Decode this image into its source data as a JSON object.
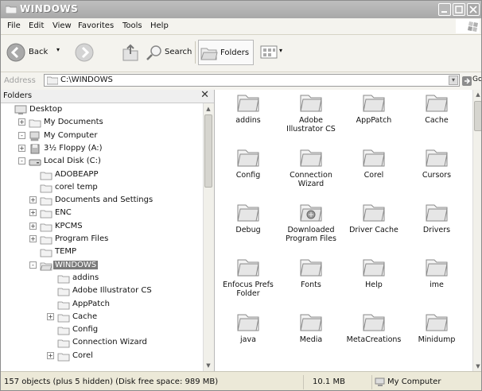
{
  "window": {
    "title": "WINDOWS"
  },
  "menu": [
    "File",
    "Edit",
    "View",
    "Favorites",
    "Tools",
    "Help"
  ],
  "toolbar": {
    "back": "Back",
    "search": "Search",
    "folders": "Folders"
  },
  "address": {
    "label": "Address",
    "value": "C:\\WINDOWS",
    "go": "Go"
  },
  "folders_pane": {
    "title": "Folders",
    "tree": [
      {
        "label": "Desktop",
        "icon": "desktop-icon",
        "level": 0,
        "expander": ""
      },
      {
        "label": "My Documents",
        "icon": "folder-icon",
        "level": 1,
        "expander": "+"
      },
      {
        "label": "My Computer",
        "icon": "computer-icon",
        "level": 1,
        "expander": "-"
      },
      {
        "label": "3½ Floppy (A:)",
        "icon": "floppy-icon",
        "level": 2,
        "expander": "+"
      },
      {
        "label": "Local Disk (C:)",
        "icon": "disk-icon",
        "level": 2,
        "expander": "-"
      },
      {
        "label": "ADOBEAPP",
        "icon": "folder-icon",
        "level": 3,
        "expander": ""
      },
      {
        "label": "corel temp",
        "icon": "folder-icon",
        "level": 3,
        "expander": ""
      },
      {
        "label": "Documents and Settings",
        "icon": "folder-icon",
        "level": 3,
        "expander": "+"
      },
      {
        "label": "ENC",
        "icon": "folder-icon",
        "level": 3,
        "expander": "+"
      },
      {
        "label": "KPCMS",
        "icon": "folder-icon",
        "level": 3,
        "expander": "+"
      },
      {
        "label": "Program Files",
        "icon": "folder-icon",
        "level": 3,
        "expander": "+"
      },
      {
        "label": "TEMP",
        "icon": "folder-icon",
        "level": 3,
        "expander": ""
      },
      {
        "label": "WINDOWS",
        "icon": "folder-open-icon",
        "level": 3,
        "expander": "-",
        "selected": true
      },
      {
        "label": "addins",
        "icon": "folder-icon",
        "level": 4,
        "expander": ""
      },
      {
        "label": "Adobe Illustrator CS",
        "icon": "folder-icon",
        "level": 4,
        "expander": ""
      },
      {
        "label": "AppPatch",
        "icon": "folder-icon",
        "level": 4,
        "expander": ""
      },
      {
        "label": "Cache",
        "icon": "folder-icon",
        "level": 4,
        "expander": "+"
      },
      {
        "label": "Config",
        "icon": "folder-icon",
        "level": 4,
        "expander": ""
      },
      {
        "label": "Connection Wizard",
        "icon": "folder-icon",
        "level": 4,
        "expander": ""
      },
      {
        "label": "Corel",
        "icon": "folder-icon",
        "level": 4,
        "expander": "+"
      }
    ]
  },
  "content": {
    "items": [
      {
        "name": "addins",
        "icon": "folder-icon"
      },
      {
        "name": "Adobe Illustrator CS",
        "icon": "folder-icon"
      },
      {
        "name": "AppPatch",
        "icon": "folder-icon"
      },
      {
        "name": "Cache",
        "icon": "folder-icon"
      },
      {
        "name": "Config",
        "icon": "folder-icon"
      },
      {
        "name": "Connection Wizard",
        "icon": "folder-icon"
      },
      {
        "name": "Corel",
        "icon": "folder-icon"
      },
      {
        "name": "Cursors",
        "icon": "folder-icon"
      },
      {
        "name": "Debug",
        "icon": "folder-icon"
      },
      {
        "name": "Downloaded Program Files",
        "icon": "folder-special-icon"
      },
      {
        "name": "Driver Cache",
        "icon": "folder-icon"
      },
      {
        "name": "Drivers",
        "icon": "folder-icon"
      },
      {
        "name": "Enfocus Prefs Folder",
        "icon": "folder-icon"
      },
      {
        "name": "Fonts",
        "icon": "folder-icon"
      },
      {
        "name": "Help",
        "icon": "folder-icon"
      },
      {
        "name": "ime",
        "icon": "folder-icon"
      },
      {
        "name": "java",
        "icon": "folder-icon"
      },
      {
        "name": "Media",
        "icon": "folder-icon"
      },
      {
        "name": "MetaCreations",
        "icon": "folder-icon"
      },
      {
        "name": "Minidump",
        "icon": "folder-icon"
      }
    ]
  },
  "status": {
    "objects": "157 objects (plus 5 hidden) (Disk free space: 989 MB)",
    "size": "10.1 MB",
    "location": "My Computer"
  }
}
